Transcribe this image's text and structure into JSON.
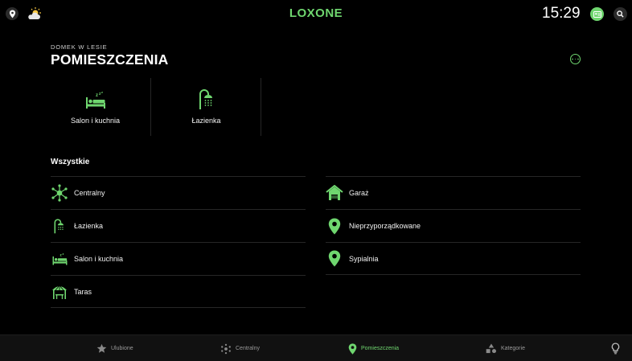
{
  "topbar": {
    "brand": "LOXONE",
    "clock": "15:29",
    "icons": [
      "location-icon",
      "weather-icon",
      "user-badge-icon",
      "search-icon"
    ]
  },
  "header": {
    "subtitle": "DOMEK W LESIE",
    "title": "POMIESZCZENIA"
  },
  "favorites": [
    {
      "label": "Salon i kuchnia",
      "icon": "bed-icon"
    },
    {
      "label": "Łazienka",
      "icon": "shower-icon"
    }
  ],
  "section_title": "Wszystkie",
  "rooms_left": [
    {
      "label": "Centralny",
      "icon": "central-hub-icon"
    },
    {
      "label": "Łazienka",
      "icon": "shower-icon"
    },
    {
      "label": "Salon i kuchnia",
      "icon": "bed-icon"
    },
    {
      "label": "Taras",
      "icon": "gazebo-icon"
    }
  ],
  "rooms_right": [
    {
      "label": "Garaż",
      "icon": "house-icon"
    },
    {
      "label": "Nieprzyporządkowane",
      "icon": "map-pin-icon"
    },
    {
      "label": "Sypialnia",
      "icon": "map-pin-icon"
    }
  ],
  "bottom_nav": [
    {
      "label": "Ulubione",
      "icon": "star-icon"
    },
    {
      "label": "Centralny",
      "icon": "central-hub-icon"
    },
    {
      "label": "Pomieszczenia",
      "icon": "map-pin-icon",
      "active": true
    },
    {
      "label": "Kategorie",
      "icon": "categories-icon"
    }
  ],
  "colors": {
    "accent": "#6fd66f",
    "background": "#000000",
    "bar": "#111111",
    "divider": "#262626"
  }
}
